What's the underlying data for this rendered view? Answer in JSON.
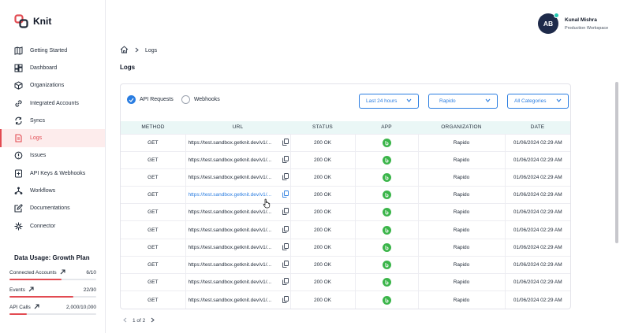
{
  "brand": {
    "name": "Knit"
  },
  "sidebar": {
    "items": [
      {
        "label": "Getting Started",
        "icon": "map-icon"
      },
      {
        "label": "Dashboard",
        "icon": "dashboard-icon"
      },
      {
        "label": "Organizations",
        "icon": "cube-icon"
      },
      {
        "label": "Integrated Accounts",
        "icon": "link-icon"
      },
      {
        "label": "Syncs",
        "icon": "sync-icon"
      },
      {
        "label": "Logs",
        "icon": "document-icon",
        "active": true
      },
      {
        "label": "Issues",
        "icon": "alert-icon"
      },
      {
        "label": "API Keys & Webhooks",
        "icon": "key-icon"
      },
      {
        "label": "Workflows",
        "icon": "workflow-icon"
      },
      {
        "label": "Documentations",
        "icon": "edit-icon"
      },
      {
        "label": "Connector",
        "icon": "connector-icon"
      }
    ]
  },
  "usage": {
    "title": "Data Usage: Growth Plan",
    "rows": [
      {
        "name": "Connected Accounts",
        "value": "6/10",
        "fraction": 0.6
      },
      {
        "name": "Events",
        "value": "22/30",
        "fraction": 0.733
      },
      {
        "name": "API Calls",
        "value": "2,000/10,000",
        "fraction": 0.2
      }
    ]
  },
  "user": {
    "initials": "AB",
    "name": "Kunal Mishra",
    "workspace": "Production Workspace"
  },
  "breadcrumb": {
    "current": "Logs"
  },
  "page": {
    "title": "Logs"
  },
  "filters": {
    "api_label": "API Requests",
    "webhooks_label": "Webhooks",
    "time": "Last 24 hours",
    "org": "Rapido",
    "category": "All Categories"
  },
  "table": {
    "headers": [
      "METHOD",
      "URL",
      "STATUS",
      "APP",
      "ORGANIZATION",
      "DATE"
    ],
    "rows": [
      {
        "method": "GET",
        "url": "https://test.sandbox.getknit.dev/v1/...",
        "status": "200 OK",
        "org": "Rapido",
        "date": "01/06/2024 02:29 AM"
      },
      {
        "method": "GET",
        "url": "https://test.sandbox.getknit.dev/v1/...",
        "status": "200 OK",
        "org": "Rapido",
        "date": "01/06/2024 02:29 AM"
      },
      {
        "method": "GET",
        "url": "https://test.sandbox.getknit.dev/v1/...",
        "status": "200 OK",
        "org": "Rapido",
        "date": "01/06/2024 02:29 AM"
      },
      {
        "method": "GET",
        "url": "https://test.sandbox.getknit.dev/v1/...",
        "status": "200 OK",
        "org": "Rapido",
        "date": "01/06/2024 02:29 AM"
      },
      {
        "method": "GET",
        "url": "https://test.sandbox.getknit.dev/v1/...",
        "status": "200 OK",
        "org": "Rapido",
        "date": "01/06/2024 02:29 AM"
      },
      {
        "method": "GET",
        "url": "https://test.sandbox.getknit.dev/v1/...",
        "status": "200 OK",
        "org": "Rapido",
        "date": "01/06/2024 02:29 AM"
      },
      {
        "method": "GET",
        "url": "https://test.sandbox.getknit.dev/v1/...",
        "status": "200 OK",
        "org": "Rapido",
        "date": "01/06/2024 02:29 AM"
      },
      {
        "method": "GET",
        "url": "https://test.sandbox.getknit.dev/v1/...",
        "status": "200 OK",
        "org": "Rapido",
        "date": "01/06/2024 02:29 AM"
      },
      {
        "method": "GET",
        "url": "https://test.sandbox.getknit.dev/v1/...",
        "status": "200 OK",
        "org": "Rapido",
        "date": "01/06/2024 02:29 AM"
      },
      {
        "method": "GET",
        "url": "https://test.sandbox.getknit.dev/v1/...",
        "status": "200 OK",
        "org": "Rapido",
        "date": "01/06/2024 02:29 AM"
      }
    ]
  },
  "pagination": {
    "label": "1 of 2"
  },
  "colors": {
    "accent": "#2a7de1",
    "brand": "#e24b52",
    "app": "#3bb54a"
  }
}
